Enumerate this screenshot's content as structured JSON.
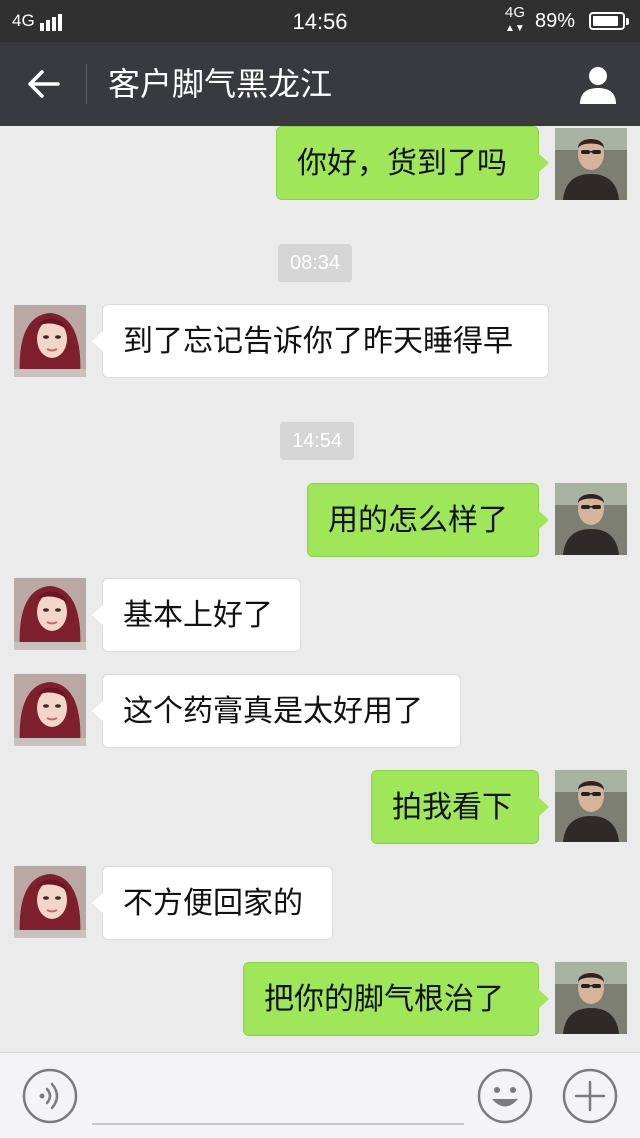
{
  "status_bar": {
    "network": "4G",
    "time": "14:56",
    "network2": "4G",
    "battery_pct": "89%",
    "battery_level": 0.89
  },
  "header": {
    "back_icon": "arrow-left-icon",
    "title": "客户脚气黑龙江",
    "profile_icon": "person-icon"
  },
  "messages": [
    {
      "side": "out",
      "text": "你好，货到了吗"
    },
    {
      "type": "time",
      "text": "08:34"
    },
    {
      "side": "in",
      "text": "到了忘记告诉你了昨天睡得早"
    },
    {
      "type": "time",
      "text": "14:54"
    },
    {
      "side": "out",
      "text": "用的怎么样了"
    },
    {
      "side": "in",
      "text": "基本上好了"
    },
    {
      "side": "in",
      "text": "这个药膏真是太好用了"
    },
    {
      "side": "out",
      "text": "拍我看下"
    },
    {
      "side": "in",
      "text": "不方便回家的"
    },
    {
      "side": "out",
      "text": "把你的脚气根治了"
    }
  ],
  "input_bar": {
    "voice_icon": "voice-icon",
    "emoji_icon": "smiley-icon",
    "plus_icon": "plus-icon"
  },
  "colors": {
    "status_bar_bg": "#303030",
    "header_bg": "#393a3f",
    "chat_bg": "#ebebeb",
    "outgoing_bubble": "#9fe658",
    "incoming_bubble": "#ffffff"
  }
}
